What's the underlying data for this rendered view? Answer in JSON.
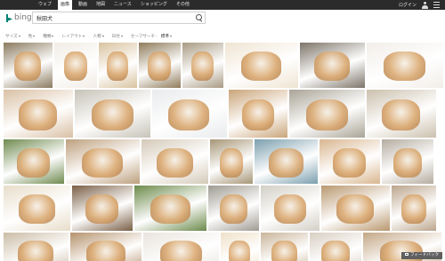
{
  "topnav": {
    "items": [
      {
        "label": "ウェブ"
      },
      {
        "label": "画像"
      },
      {
        "label": "動画"
      },
      {
        "label": "地図"
      },
      {
        "label": "ニュース"
      },
      {
        "label": "ショッピング"
      },
      {
        "label": "その他"
      }
    ],
    "login_label": "ログイン"
  },
  "brand": {
    "name": "bing",
    "accent": "#008373"
  },
  "search": {
    "value": "秋田犬"
  },
  "filters": [
    {
      "label": "サイズ"
    },
    {
      "label": "色"
    },
    {
      "label": "種類"
    },
    {
      "label": "レイアウト"
    },
    {
      "label": "人物"
    },
    {
      "label": "日付"
    },
    {
      "label": "セーフサーチ"
    },
    {
      "label": "標準"
    }
  ],
  "feedback": {
    "label": "フィードバック"
  },
  "images": {
    "row1": [
      "#8a7a5e",
      "#f1ece4",
      "#d9c3a0",
      "#8f7b5a",
      "#a89a82",
      "#efe4d2",
      "#7c7468",
      "#f2eee9"
    ],
    "row2": [
      "#d9c0a4",
      "#c7c3b8",
      "#e9ebec",
      "#caa57a",
      "#a9a496",
      "#cbc0ad"
    ],
    "row3": [
      "#6f8a4f",
      "#bda07e",
      "#d4c9b8",
      "#a69676",
      "#7b9fae",
      "#d9b690",
      "#b4aca0"
    ],
    "row4": [
      "#e8ddca",
      "#7a5f46",
      "#6c8a4a",
      "#9f9a92",
      "#d3cfc6",
      "#b9986f",
      "#bba58c"
    ],
    "row5": [
      "#cabca6",
      "#b5936d",
      "#e9e4dd",
      "#efe1c9",
      "#c9b59a",
      "#d8cec2",
      "#c4a786"
    ]
  }
}
